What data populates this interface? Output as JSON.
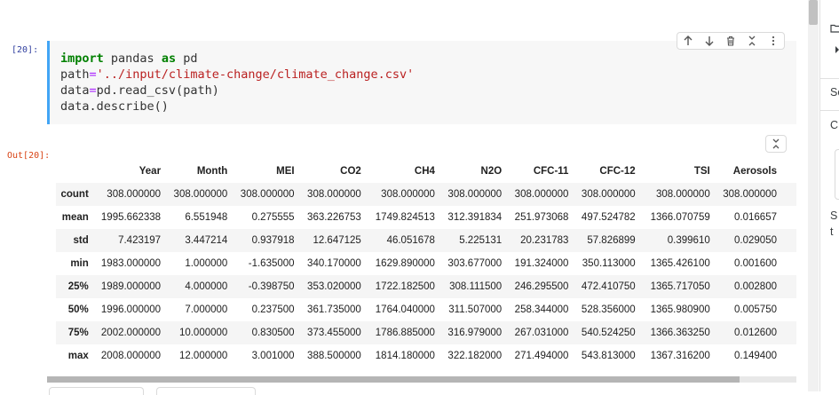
{
  "input_cell": {
    "prompt": "[20]:",
    "code_lines": [
      [
        {
          "t": "import",
          "c": "kw"
        },
        {
          "t": " pandas ",
          "c": ""
        },
        {
          "t": "as",
          "c": "kw"
        },
        {
          "t": " pd",
          "c": ""
        }
      ],
      [
        {
          "t": "path",
          "c": ""
        },
        {
          "t": "=",
          "c": "op"
        },
        {
          "t": "'../input/climate-change/climate_change.csv'",
          "c": "str"
        }
      ],
      [
        {
          "t": "data",
          "c": ""
        },
        {
          "t": "=",
          "c": "op"
        },
        {
          "t": "pd.read_csv(path)",
          "c": ""
        }
      ],
      [
        {
          "t": "data.describe()",
          "c": ""
        }
      ]
    ]
  },
  "toolbar": {
    "icons": [
      "arrow-up-icon",
      "arrow-down-icon",
      "delete-icon",
      "collapse-icon",
      "more-vert-icon"
    ]
  },
  "output_cell": {
    "prompt": "Out[20]:",
    "columns": [
      "",
      "Year",
      "Month",
      "MEI",
      "CO2",
      "CH4",
      "N2O",
      "CFC-11",
      "CFC-12",
      "TSI",
      "Aerosols"
    ],
    "rows": [
      [
        "count",
        "308.000000",
        "308.000000",
        "308.000000",
        "308.000000",
        "308.000000",
        "308.000000",
        "308.000000",
        "308.000000",
        "308.000000",
        "308.000000"
      ],
      [
        "mean",
        "1995.662338",
        "6.551948",
        "0.275555",
        "363.226753",
        "1749.824513",
        "312.391834",
        "251.973068",
        "497.524782",
        "1366.070759",
        "0.016657"
      ],
      [
        "std",
        "7.423197",
        "3.447214",
        "0.937918",
        "12.647125",
        "46.051678",
        "5.225131",
        "20.231783",
        "57.826899",
        "0.399610",
        "0.029050"
      ],
      [
        "min",
        "1983.000000",
        "1.000000",
        "-1.635000",
        "340.170000",
        "1629.890000",
        "303.677000",
        "191.324000",
        "350.113000",
        "1365.426100",
        "0.001600"
      ],
      [
        "25%",
        "1989.000000",
        "4.000000",
        "-0.398750",
        "353.020000",
        "1722.182500",
        "308.111500",
        "246.295500",
        "472.410750",
        "1365.717050",
        "0.002800"
      ],
      [
        "50%",
        "1996.000000",
        "7.000000",
        "0.237500",
        "361.735000",
        "1764.040000",
        "311.507000",
        "258.344000",
        "528.356000",
        "1365.980900",
        "0.005750"
      ],
      [
        "75%",
        "2002.000000",
        "10.000000",
        "0.830500",
        "373.455000",
        "1786.885000",
        "316.979000",
        "267.031000",
        "540.524250",
        "1366.363250",
        "0.012600"
      ],
      [
        "max",
        "2008.000000",
        "12.000000",
        "3.001000",
        "388.500000",
        "1814.180000",
        "322.182000",
        "271.494000",
        "543.813000",
        "1367.316200",
        "0.149400"
      ]
    ]
  },
  "side_panel": {
    "text_1": "Se",
    "text_2": "C",
    "text_3": "S",
    "text_4": "t"
  },
  "colors": {
    "cell_border_active": "#42a5f5",
    "input_prompt": "#303f9f",
    "output_prompt": "#d84315"
  }
}
